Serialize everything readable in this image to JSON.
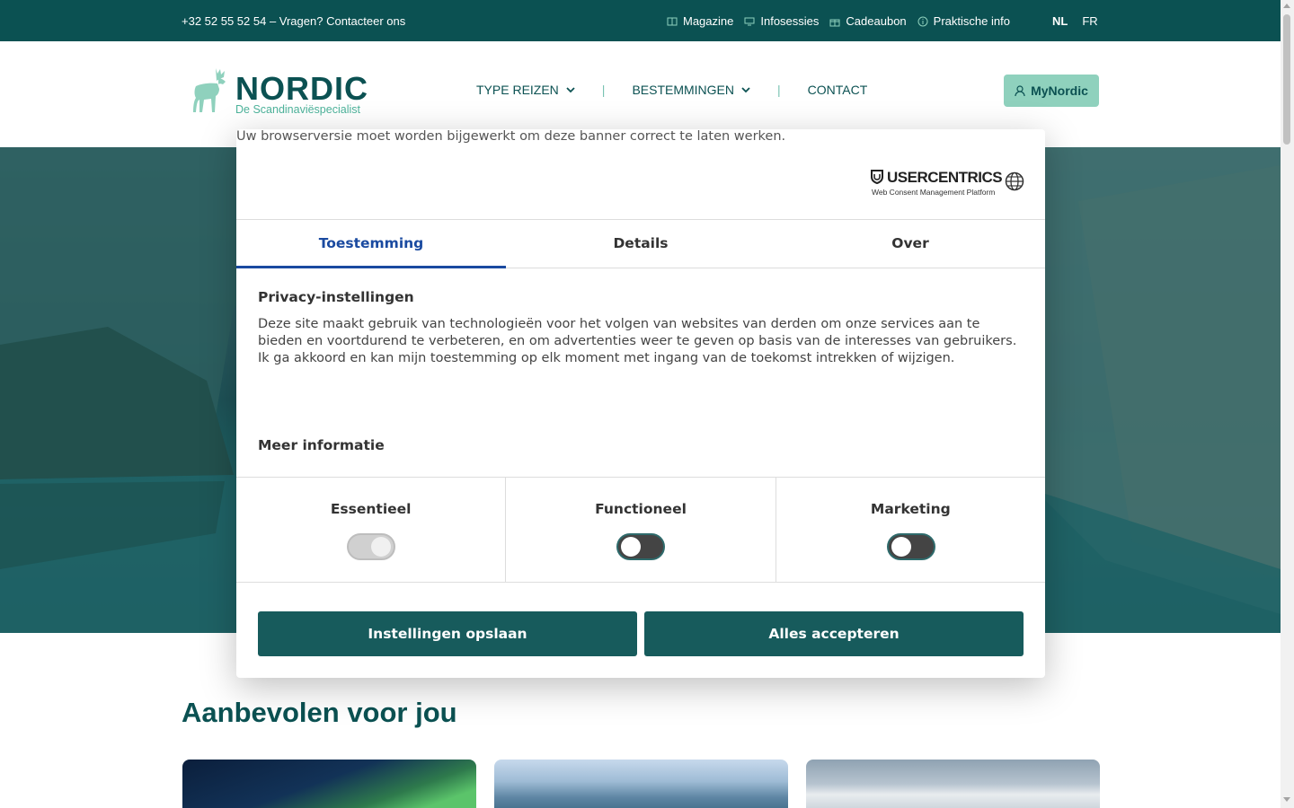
{
  "topbar": {
    "phone": "+32 52 55 52 54 – Vragen? Contacteer ons",
    "links": [
      {
        "label": "Magazine",
        "icon": "magazine-icon"
      },
      {
        "label": "Infosessies",
        "icon": "monitor-icon"
      },
      {
        "label": "Cadeaubon",
        "icon": "gift-icon"
      },
      {
        "label": "Praktische info",
        "icon": "info-icon"
      }
    ],
    "languages": [
      "NL",
      "FR"
    ],
    "active_language": "NL"
  },
  "header": {
    "logo_word": "NORDIC",
    "logo_sub": "De Scandinaviëspecialist",
    "nav": [
      {
        "label": "TYPE REIZEN",
        "dropdown": true
      },
      {
        "label": "BESTEMMINGEN",
        "dropdown": true
      },
      {
        "label": "CONTACT",
        "dropdown": false
      }
    ],
    "nav_separator": "|",
    "mynordic": "MyNordic"
  },
  "recommended": {
    "title": "Aanbevolen voor jou"
  },
  "consent": {
    "browser_note": "Uw browserversie moet worden bijgewerkt om deze banner correct te laten werken.",
    "brand": "USERCENTRICS",
    "brand_sub": "Web Consent Management Platform",
    "tabs": [
      "Toestemming",
      "Details",
      "Over"
    ],
    "active_tab": "Toestemming",
    "privacy_heading": "Privacy-instellingen",
    "privacy_text": "Deze site maakt gebruik van technologieën voor het volgen van websites van derden om onze services aan te bieden en voortdurend te verbeteren, en om advertenties weer te geven op basis van de interesses van gebruikers. Ik ga akkoord en kan mijn toestemming op elk moment met ingang van de toekomst intrekken of wijzigen.",
    "more_info": "Meer informatie",
    "categories": [
      {
        "label": "Essentieel",
        "state": "on-disabled"
      },
      {
        "label": "Functioneel",
        "state": "off"
      },
      {
        "label": "Marketing",
        "state": "off"
      }
    ],
    "save_button": "Instellingen opslaan",
    "accept_button": "Alles accepteren"
  },
  "colors": {
    "brand_dark": "#0b5152",
    "brand_mint": "#8fd1bd",
    "consent_button": "#175b5c",
    "active_tab": "#1a4aa0"
  }
}
